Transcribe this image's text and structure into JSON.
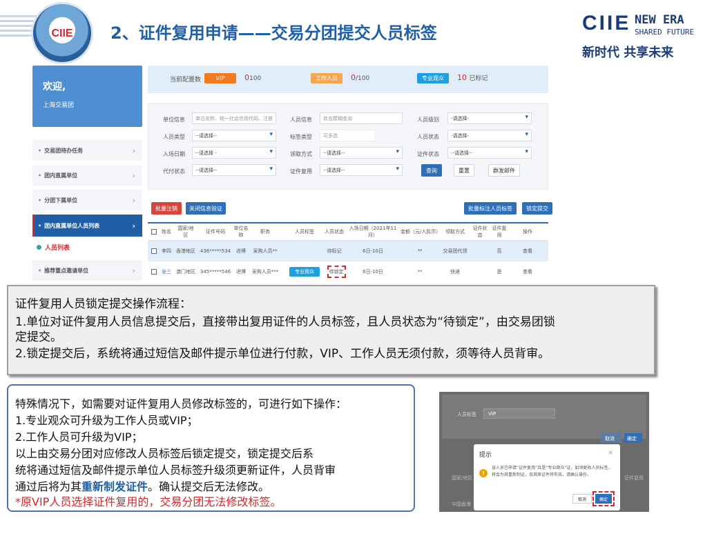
{
  "header": {
    "logo_text": "CIIE",
    "title": "2、证件复用申请——交易分团提交人员标签",
    "brand_ciie": "CIIE",
    "brand_newera": "NEW ERA",
    "brand_shared": "SHARED FUTURE",
    "brand_cn": "新时代  共享未来"
  },
  "sidebar": {
    "welcome": "欢迎,",
    "org": "上海交易团",
    "items": [
      {
        "label": "交易团待办任务"
      },
      {
        "label": "团内直属单位"
      },
      {
        "label": "分团下属单位"
      },
      {
        "label": "团内直属单位人员列表"
      }
    ],
    "sub_item": "人员列表",
    "last_item": "推荐重点邀请单位"
  },
  "counts": {
    "label": "当前配置数",
    "vip_badge": "VIP",
    "vip_count": "0",
    "vip_total": "100",
    "staff_badge": "工作人员",
    "staff_count": "0",
    "staff_total": "/100",
    "audience_badge": "专业观众",
    "audience_count": "10",
    "audience_suffix": "已标记"
  },
  "filter": {
    "unit_info_label": "单位信息",
    "unit_info_placeholder": "单位名称、统一社会信用代码、注册",
    "person_info_label": "人员信息",
    "person_info_placeholder": "姓名模糊查询",
    "person_level_label": "人员级别",
    "person_level_value": "-请选择-",
    "person_type_label": "人员类型",
    "person_type_value": "--请选择--",
    "tag_type_label": "标签类型",
    "tag_type_placeholder": "可多选",
    "person_status_label": "人员状态",
    "person_status_value": "-请选择-",
    "entry_date_label": "入场日期",
    "entry_date_value": "--请选择 -",
    "pickup_label": "领取方式",
    "pickup_value": "--请选择--",
    "cert_status_label": "证件状态",
    "cert_status_value": "--请选择--",
    "pay_status_label": "代付状态",
    "pay_status_value": "--请选择--",
    "cert_reuse_label": "证件复用",
    "cert_reuse_value": "--请选择--",
    "query_btn": "查询",
    "reset_btn": "重置",
    "mail_btn": "群发邮件"
  },
  "actions": {
    "batch_cancel": "批量注销",
    "close_verify": "关闭信息验证",
    "batch_tag": "批量标注人员标签",
    "lock_submit": "锁定提交"
  },
  "table": {
    "headers": [
      "姓名",
      "国家/地区",
      "证件号码",
      "单位名称",
      "职务",
      "人员标签",
      "人员状态",
      "入场日期（2021年11月）",
      "金额（元/人民币）",
      "领取方式",
      "证件状态",
      "证件复用",
      "操作"
    ],
    "rows": [
      [
        "李四",
        "香港地区",
        "436*****534",
        "进博",
        "采购人员**",
        "",
        "待标记",
        "6日-10日",
        "**",
        "交易团代领",
        "",
        "否",
        "查看"
      ],
      [
        "张三",
        "澳门地区",
        "345*****546",
        "进博",
        "采购人员***",
        "专业观众",
        "待锁定",
        "6日-10日",
        "**",
        "快递",
        "",
        "是",
        "查看"
      ]
    ]
  },
  "box1": {
    "lines": [
      "证件复用人员锁定提交操作流程：",
      "1.单位对证件复用人员信息提交后，直接带出复用证件的人员标签，且人员状态为“待锁定”，由交易团锁",
      "定提交。",
      "2.锁定提交后，系统将通过短信及邮件提示单位进行付款，VIP、工作人员无须付款，须等待人员背审。"
    ]
  },
  "box2": {
    "line1": "特殊情况下，如需要对证件复用人员修改标签的，可进行如下操作：",
    "line2": "1.专业观众可升级为工作人员或VIP；",
    "line3": "2.工作人员可升级为VIP；",
    "line4": "以上由交易分团对应修改人员标签后锁定提交，锁定提交后系",
    "line5": "统将通过短信及邮件提示单位人员标签升级须更新证件，人员背审",
    "line6_a": "通过后将为其",
    "line6_b": "重新制发证件",
    "line6_c": "。确认提交后无法修改。",
    "line7": "*原VIP人员选择证件复用的，交易分团无法修改标签。"
  },
  "modal_shot": {
    "tag_label": "人员标签",
    "tag_value": "VIP",
    "cancel": "取消",
    "confirm": "确定",
    "dialog_title": "提示",
    "dialog_msg": "该人员已申请“证件复用”且是“专业观众”证，如须更改人员标签，将会为其重新制证，且其原证件将失效，请确认操作。",
    "dialog_cancel": "取消",
    "dialog_ok": "确定",
    "col1": "国家/地区",
    "col2": "证件复用",
    "row1": "中国香港"
  },
  "colors": {
    "vip": "#f47920",
    "staff": "#f7a64c",
    "audience": "#1ea0e0",
    "primary": "#2f6fb8",
    "danger": "#d6262b"
  }
}
